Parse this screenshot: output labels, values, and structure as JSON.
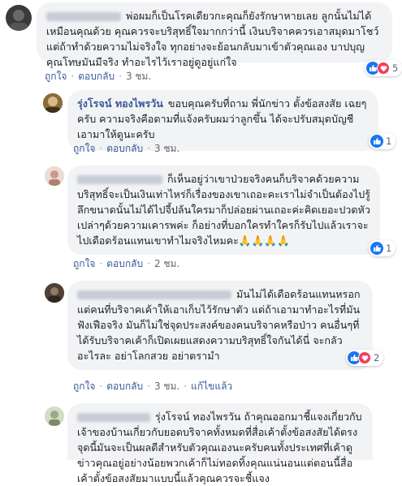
{
  "action_labels": {
    "like": "ถูกใจ",
    "reply": "ตอบกลับ",
    "separator": "·",
    "edited": "แก้ไขแล้ว"
  },
  "comments": [
    {
      "text": "พ่อผมก็เป็นโรคเดียวกะคุณก็ยังรักษาหายเลย ลูกนั้นไม่ได้เหมือนคุณด้วย คุณควรจะบริสุทธิ์ใจมากกว่านี้ เงินบริจาคควรเอาสมุดมาโชว์ แต่ถ้าทำด้วยความไม่จริงใจ ทุกอย่างจะย้อนกลับมาเข้าตัวคุณเอง บาปบุญคุณโทษมันมีจริง ทำอะไรไว้เราอยู่ดูอยู่แก่ใจ",
      "time": "3 ชม.",
      "reactions": "5",
      "reaction_icons": [
        "like-icon",
        "love-icon"
      ]
    },
    {
      "author": "รุ่งโรจน์ ทองไพรวัน",
      "text": "ขอบคุณครับที่ถาม พี่นักข่าว ตั้งข้อสงสัย เฉยๆ ครับ ความจริงคือตามที่แจ้งครับผมว่าลูกขึ้น ได้จะปรับสมุดบัญชี เอามาให้ดูนะครับ",
      "time": "3 ชม.",
      "reactions": "1",
      "reaction_icons": [
        "like-icon"
      ]
    },
    {
      "text": "ก็เห็นอยู่ว่าเขาป่วยจริงคนก็บริจาคด้วยความบริสุทธิ์จะเป็นเงินเท่าไหร่ก็เรื่องของเขาเถอะคะเราไม่จำเป็นต้องไปรู้ลึกขนาดนั้นไม่ได้ไปจี้ปล้นใครมาก็ปล่อยผ่านเถอะค่ะคิดเยอะปวดหัวเปล่าๆด้วยความเคารพค่ะ ก็อย่างที่บอกใครทำใครก็รับไปแล้วเราจะไปเดือดร้อนแทนเขาทำไมจริงไหมคะ🙏🙏🙏🙏",
      "time": "2 ชม.",
      "reactions": "1",
      "reaction_icons": [
        "like-icon"
      ]
    },
    {
      "text": "มันไม่ได้เดือดร้อนแทนหรอก แต่คนที่บริจาคเค้าให้เอาเก็บไว้รักษาตัว แต่ถ้าเอามาทำอะไรที่มันฟังเฟือจริง มันก็ไม่ใช่จุดประสงค์ของคนบริจาคหรือป่าว คนอื่นๆที่ได้รับบริจาคเค้าก็เปิดเผยแสดงความบริสุทธิ์ใจกันได้นี่ จะกลัวอะไรละ อย่าโลกสวย อย่าตรามำ",
      "time": "3 ชม.",
      "edited": true,
      "reactions": "2",
      "reaction_icons": [
        "like-icon",
        "love-icon"
      ]
    },
    {
      "text": "รุ่งโรจน์ ทองไพรวัน ถ้าคุณออกมาชี้แจงเกี่ยวกับเจ้าของบ้านเกี่ยวกับยอดบริจาคทั้งหมดที่สื่อเค้าตั้งข้อสงสัยได้ตรงจุดนี้มันจะเป็นผลดีสำหรับตัวคุณเองนะครับคนทั้งประเทศที่เค้าดูข่าวคุณอยู่อย่างน้อยพวกเค้าก็ไม่ทอดทิ้งคุณแน่นอนแต่ตอนนี้สื่อเค้าตั้งข้อสงสัยมาแบบนี้แล้วคุณควรจะชี้แจง"
    }
  ]
}
